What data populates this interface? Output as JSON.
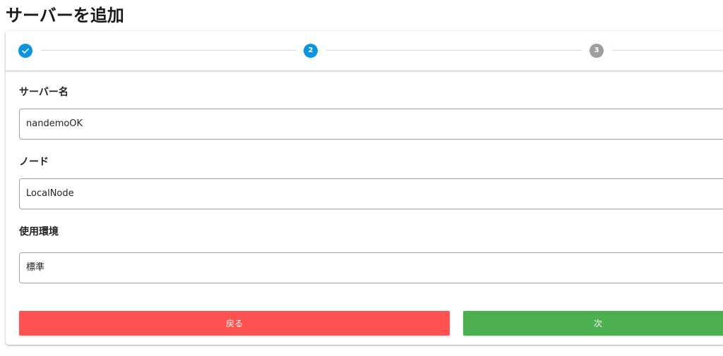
{
  "page": {
    "title": "サーバーを追加"
  },
  "stepper": {
    "steps": [
      {
        "label": "",
        "state": "completed",
        "icon": "check-icon",
        "color": "#0a95e0"
      },
      {
        "label": "2",
        "state": "active",
        "color": "#0a95e0"
      },
      {
        "label": "3",
        "state": "inactive",
        "color": "#9e9e9e"
      }
    ]
  },
  "form": {
    "server_name": {
      "label": "サーバー名",
      "value": "nandemoOK"
    },
    "node": {
      "label": "ノード",
      "value": "LocalNode"
    },
    "environment": {
      "label": "使用環境",
      "value": "標準"
    }
  },
  "buttons": {
    "back": {
      "label": "戻る",
      "color": "#ff5252"
    },
    "next": {
      "label": "次",
      "color": "#4caf50"
    }
  }
}
